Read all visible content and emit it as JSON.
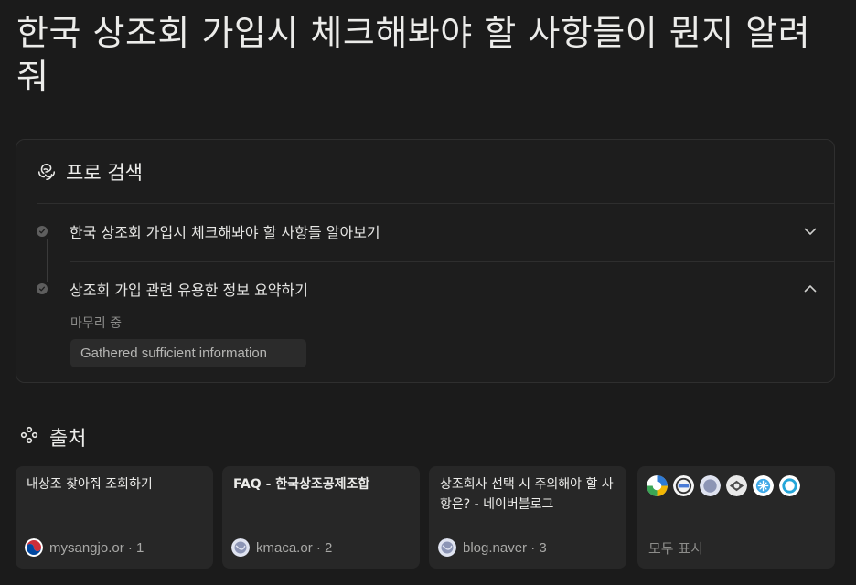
{
  "query": {
    "title": "한국 상조회 가입시 체크해봐야 할 사항들이 뭔지 알려줘"
  },
  "pro_search": {
    "label": "프로 검색",
    "steps": [
      {
        "label": "한국 상조회 가입시 체크해봐야 할 사항들 알아보기",
        "state": "collapsed"
      },
      {
        "label": "상조회 가입 관련 유용한 정보 요약하기",
        "state": "expanded"
      }
    ],
    "status": "마무리 중",
    "chip": "Gathered sufficient information"
  },
  "sources": {
    "label": "출처",
    "items": [
      {
        "title": "내상조 찾아줘 조회하기",
        "domain": "mysangjo.or",
        "index": "1",
        "meta": "mysangjo.or · 1"
      },
      {
        "title": "FAQ - 한국상조공제조합",
        "domain": "kmaca.or",
        "index": "2",
        "meta": "kmaca.or · 2"
      },
      {
        "title": "상조회사 선택 시 주의해야 할 사항은? - 네이버블로그",
        "domain": "blog.naver",
        "index": "3",
        "meta": "blog.naver · 3"
      }
    ],
    "show_all": "모두 표시"
  },
  "colors": {
    "background": "#1b1b1b",
    "card": "#272727",
    "border": "#2f2f2f",
    "text": "#ececea",
    "muted": "#8c8c8a"
  }
}
